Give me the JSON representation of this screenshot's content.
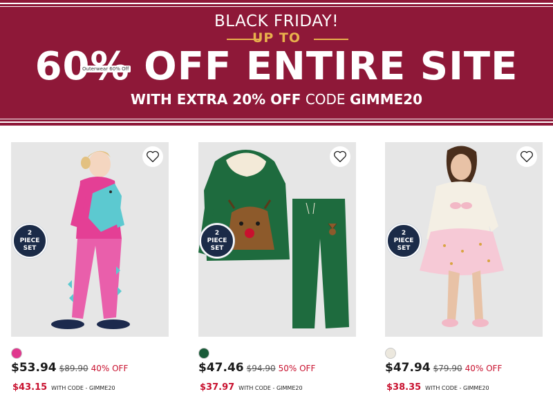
{
  "banner": {
    "line1": "BLACK FRIDAY!",
    "upto": "UP TO",
    "line2": "60% OFF ENTIRE SITE",
    "tag": "Outerwear 60% Off",
    "line3_prefix": "WITH EXTRA 20% OFF",
    "line3_mid": " CODE ",
    "line3_code": "GIMME20",
    "colors": {
      "background": "#8e1838",
      "accent": "#e8b14c"
    }
  },
  "products": [
    {
      "badge_line1": "2",
      "badge_line2": "PIECE",
      "badge_line3": "SET",
      "swatch_color": "#e0388e",
      "price": "$53.94",
      "original_price": "$89.90",
      "discount": "40% OFF",
      "code_price": "$43.15",
      "code_label": "WITH CODE - GIMME20",
      "image": "girl-pink-dinosaur-hoodie-jogger-set"
    },
    {
      "badge_line1": "2",
      "badge_line2": "PIECE",
      "badge_line3": "SET",
      "swatch_color": "#1a5c3a",
      "price": "$47.46",
      "original_price": "$94.90",
      "discount": "50% OFF",
      "code_price": "$37.97",
      "code_label": "WITH CODE - GIMME20",
      "image": "green-reindeer-hoodie-jogger-set"
    },
    {
      "badge_line1": "2",
      "badge_line2": "PIECE",
      "badge_line3": "SET",
      "swatch_color": "#ece8de",
      "price": "$47.94",
      "original_price": "$79.90",
      "discount": "40% OFF",
      "code_price": "$38.35",
      "code_label": "WITH CODE - GIMME20",
      "image": "girl-ballet-sweater-tutu-skirt-set"
    }
  ]
}
